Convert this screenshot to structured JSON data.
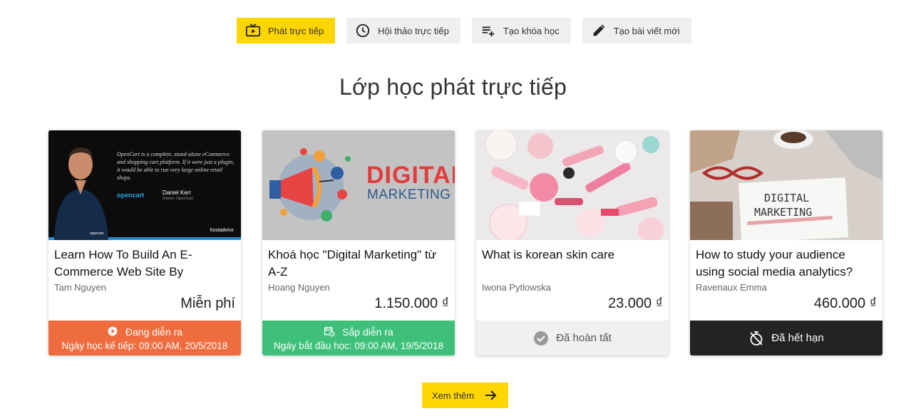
{
  "tabs": [
    {
      "label": "Phát trực tiếp",
      "icon": "tv-play-icon",
      "active": true
    },
    {
      "label": "Hội thảo trực tiếp",
      "icon": "clock-icon",
      "active": false
    },
    {
      "label": "Tạo khóa học",
      "icon": "playlist-add-icon",
      "active": false
    },
    {
      "label": "Tạo bài viết mới",
      "icon": "pencil-icon",
      "active": false
    }
  ],
  "section_title": "Lớp học phát trực tiếp",
  "cards": [
    {
      "title": "Learn How To Build An E-Commerce Web Site By",
      "author": "Tam Nguyen",
      "price": "Miễn phí",
      "status": "Đang diễn ra",
      "status_detail": "Ngày học kế tiếp: 09:00 AM, 20/5/2018",
      "status_icon": "play-circle-icon",
      "status_color": "#ef6c3f",
      "thumb": {
        "quote": "OpenCart is a complete, stand-alone eCommerce and shopping cart platform. If it were just a plugin, it would be able to run very large online retail shops.",
        "brand": "opencart",
        "person": "Daniel Kerr",
        "role": "Owner, OpenCart",
        "watermark": "hostadvice"
      }
    },
    {
      "title": "Khoá học \"Digital Marketing\" từ A-Z",
      "author": "Hoang Nguyen",
      "price": "1.150.000 ₫",
      "status": "Sắp diễn ra",
      "status_detail": "Ngày bắt đầu học: 09:00 AM, 19/5/2018",
      "status_icon": "calendar-clock-icon",
      "status_color": "#3ec07a",
      "thumb": {
        "line1": "DIGITAL",
        "line2": "MARKETING"
      }
    },
    {
      "title": "What is korean skin care",
      "author": "Iwona Pytlowska",
      "price": "23.000 ₫",
      "status": "Đã hoàn tất",
      "status_icon": "check-circle-icon",
      "status_color": "#f0f0f0"
    },
    {
      "title": "How to study your audience using social media analytics?",
      "author": "Ravenaux Emma",
      "price": "460.000 ₫",
      "status": "Đã hết hạn",
      "status_icon": "timer-off-icon",
      "status_color": "#232323",
      "thumb": {
        "line1": "DIGITAL",
        "line2": "MARKETING"
      }
    }
  ],
  "more_button": {
    "label": "Xem thêm",
    "icon": "arrow-right-icon"
  },
  "colors": {
    "accent": "#ffd600",
    "live": "#ef6c3f",
    "upcoming": "#3ec07a",
    "expired": "#232323"
  }
}
